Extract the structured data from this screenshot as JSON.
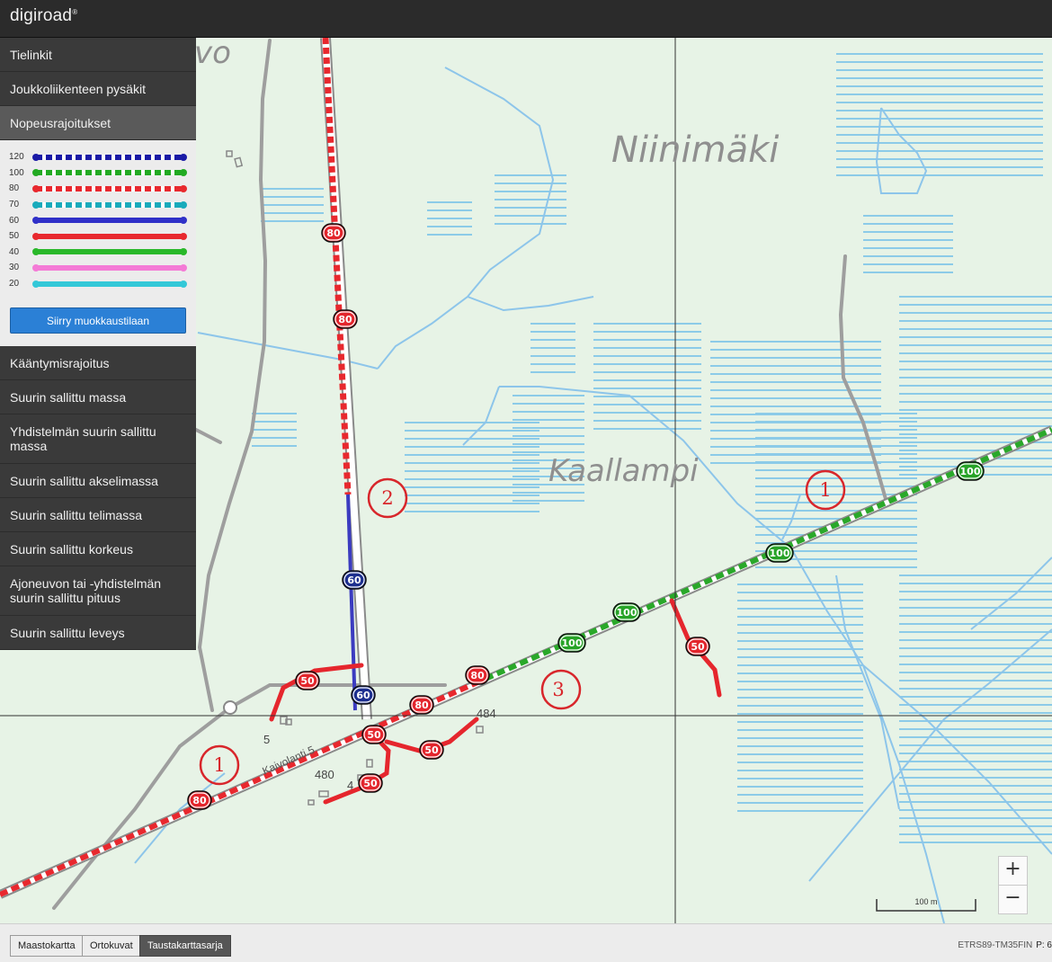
{
  "app": {
    "logo": "digiroad",
    "logo_mark": "®"
  },
  "sidebar": {
    "top_items": [
      {
        "label": "Tielinkit"
      },
      {
        "label": "Joukkoliikenteen pysäkit"
      },
      {
        "label": "Nopeusrajoitukset"
      }
    ],
    "active_item": "Nopeusrajoitukset",
    "legend": [
      {
        "label": "120",
        "color": "#1a1aa6",
        "dashed": true
      },
      {
        "label": "100",
        "color": "#22aa22",
        "dashed": true
      },
      {
        "label": "80",
        "color": "#e8282e",
        "dashed": true
      },
      {
        "label": "70",
        "color": "#19aabb",
        "dashed": true
      },
      {
        "label": "60",
        "color": "#3030c8",
        "dashed": false
      },
      {
        "label": "50",
        "color": "#e8282e",
        "dashed": false
      },
      {
        "label": "40",
        "color": "#2ab82a",
        "dashed": false
      },
      {
        "label": "30",
        "color": "#f47ad6",
        "dashed": false
      },
      {
        "label": "20",
        "color": "#33c8d8",
        "dashed": false
      }
    ],
    "edit_button": "Siirry muokkaustilaan",
    "bottom_items": [
      {
        "label": "Kääntymisrajoitus"
      },
      {
        "label": "Suurin sallittu massa"
      },
      {
        "label": "Yhdistelmän suurin sallittu massa"
      },
      {
        "label": "Suurin sallittu akselimassa"
      },
      {
        "label": "Suurin sallittu telimassa"
      },
      {
        "label": "Suurin sallittu korkeus"
      },
      {
        "label": "Ajoneuvon tai -yhdistelmän suurin sallittu pituus"
      },
      {
        "label": "Suurin sallittu leveys"
      }
    ]
  },
  "map": {
    "place_names": {
      "niinimaki": "Niinimäki",
      "kaallampi": "Kaallampi",
      "partial_vo": "vo"
    },
    "road_name": "Kaivolanti.5",
    "house_numbers": {
      "n484": "484",
      "n480": "480",
      "n5": "5",
      "n4": "4"
    },
    "speed_signs": {
      "s80a": "80",
      "s80b": "80",
      "s60a": "60",
      "s60b": "60",
      "s50a": "50",
      "s50b": "50",
      "s50c": "50",
      "s50d": "50",
      "s50e": "50",
      "s80c": "80",
      "s80d": "80",
      "s80e": "80",
      "s100a": "100",
      "s100b": "100",
      "s100c": "100",
      "s100d": "100"
    },
    "annotations": {
      "a1_right": "1",
      "a2": "2",
      "a3": "3",
      "a1_left": "1"
    },
    "scale_label": "100 m",
    "zoom_in": "+",
    "zoom_out": "−"
  },
  "bottom_bar": {
    "layers": [
      {
        "label": "Maastokartta",
        "active": false
      },
      {
        "label": "Ortokuvat",
        "active": false
      },
      {
        "label": "Taustakarttasarja",
        "active": true
      }
    ],
    "projection": "ETRS89-TM35FIN",
    "coord_prefix": "P: 6"
  }
}
